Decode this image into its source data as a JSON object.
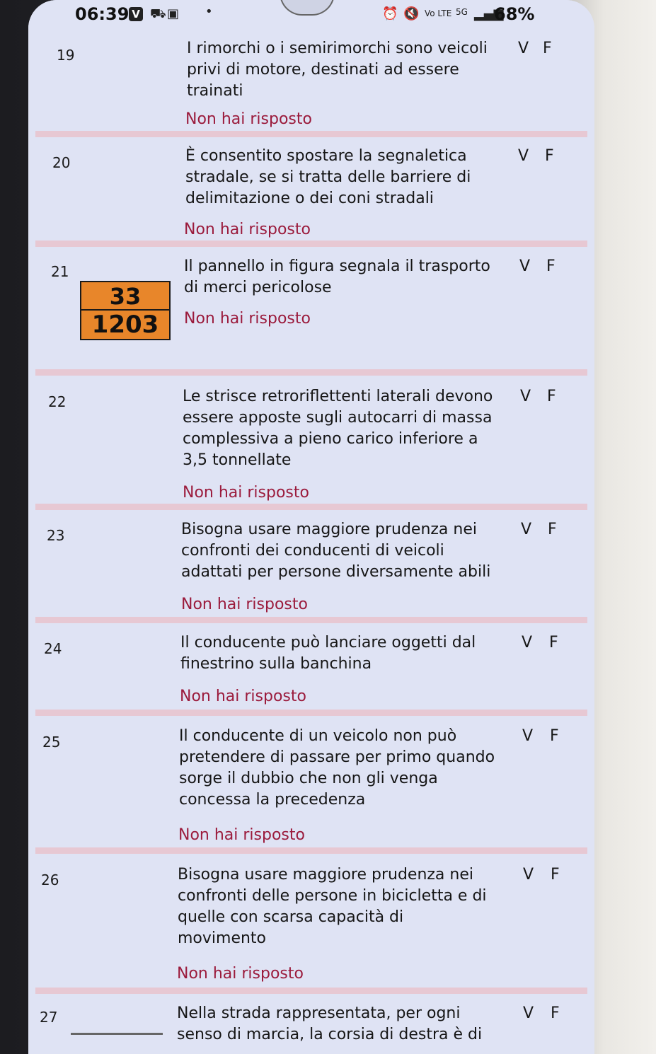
{
  "statusbar": {
    "time": "06:39",
    "v_badge": "V",
    "battery": "68%",
    "network": "5G"
  },
  "questions": [
    {
      "num": "19",
      "text": "I rimorchi o i semirimorchi sono veicoli\nprivi di motore, destinati ad essere\ntrainati",
      "status": "Non hai risposto",
      "v": "V",
      "f": "F"
    },
    {
      "num": "20",
      "text": "È consentito spostare la segnaletica\nstradale, se si tratta delle barriere di\ndelimitazione o dei coni stradali",
      "status": "Non hai risposto",
      "v": "V",
      "f": "F"
    },
    {
      "num": "21",
      "text": "Il pannello in figura segnala il trasporto\ndi merci pericolose",
      "status": "Non hai risposto",
      "v": "V",
      "f": "F",
      "sign_top": "33",
      "sign_bottom": "1203"
    },
    {
      "num": "22",
      "text": "Le strisce retroriflettenti laterali devono\nessere apposte sugli autocarri di massa\ncomplessiva a pieno carico inferiore a\n3,5 tonnellate",
      "status": "Non hai risposto",
      "v": "V",
      "f": "F"
    },
    {
      "num": "23",
      "text": "Bisogna usare maggiore prudenza nei\nconfronti dei conducenti di veicoli\nadattati per persone diversamente abili",
      "status": "Non hai risposto",
      "v": "V",
      "f": "F"
    },
    {
      "num": "24",
      "text": "Il conducente può lanciare oggetti dal\nfinestrino sulla banchina",
      "status": "Non hai risposto",
      "v": "V",
      "f": "F"
    },
    {
      "num": "25",
      "text": "Il conducente di un veicolo non può\npretendere di passare per primo quando\nsorge il dubbio che non gli venga\nconcessa la precedenza",
      "status": "Non hai risposto",
      "v": "V",
      "f": "F"
    },
    {
      "num": "26",
      "text": "Bisogna usare maggiore prudenza nei\nconfronti delle persone in bicicletta e di\nquelle con scarsa capacità di\nmovimento",
      "status": "Non hai risposto",
      "v": "V",
      "f": "F"
    },
    {
      "num": "27",
      "text": "Nella strada rappresentata, per ogni\nsenso di marcia, la corsia di destra è di",
      "v": "V",
      "f": "F"
    }
  ]
}
